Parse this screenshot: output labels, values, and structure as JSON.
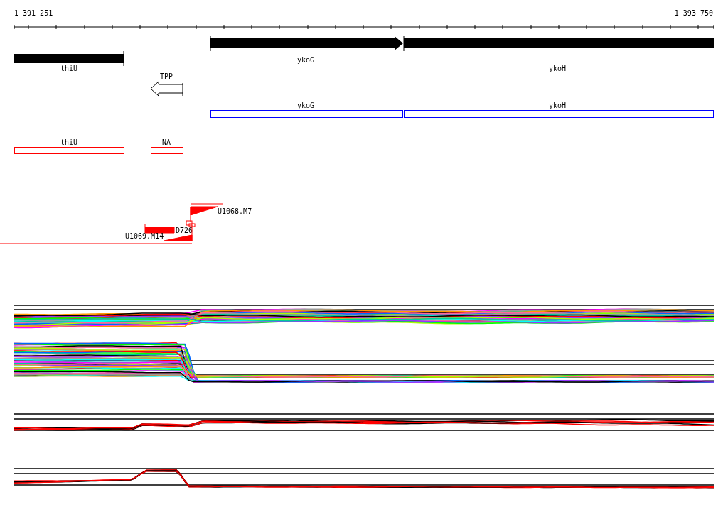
{
  "ruler": {
    "start": "1 391 251",
    "end": "1 393 750"
  },
  "genes": [
    {
      "name": "thiU",
      "arrow": false
    },
    {
      "name": "ykoG",
      "arrow": true
    },
    {
      "name": "ykoH",
      "arrow": false
    }
  ],
  "riboswitches": [
    {
      "label": "TPP"
    }
  ],
  "predicted_genes": [
    {
      "name": "ykoG"
    },
    {
      "name": "ykoH"
    }
  ],
  "annotations": [
    {
      "name": "thiU"
    },
    {
      "name": "NA"
    }
  ],
  "breakpoints": [
    {
      "label": "U1068.M7",
      "kind": "up"
    },
    {
      "label": "D726",
      "kind": "deletion"
    },
    {
      "label": "U1069.M14",
      "kind": "down"
    }
  ]
}
